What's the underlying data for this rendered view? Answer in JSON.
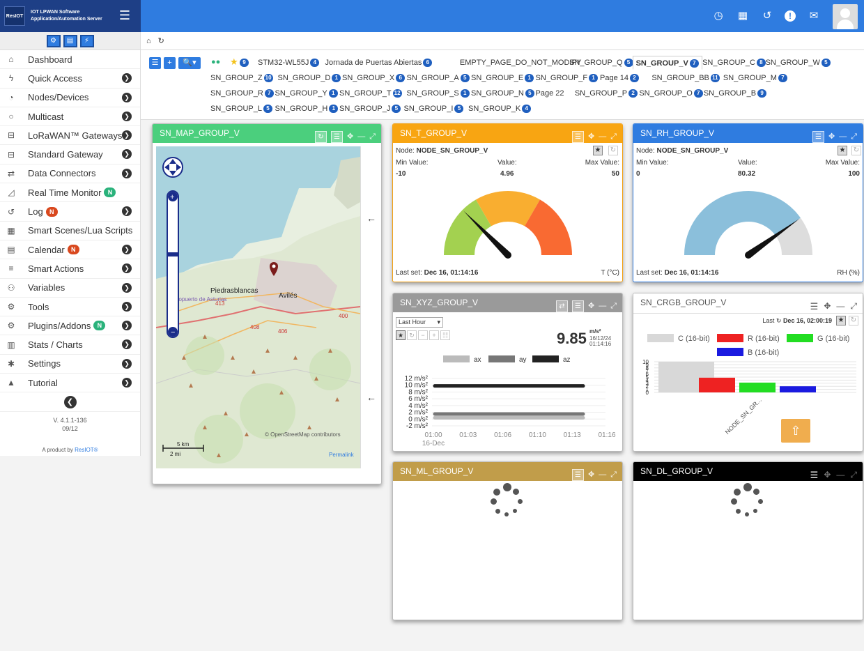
{
  "brand": {
    "logo": "ResIOT",
    "line1": "IOT LPWAN Software",
    "line2": "Application/Automation Server"
  },
  "topbar": {
    "icons": [
      "clock-icon",
      "film-icon",
      "history-icon",
      "alert-icon",
      "envelope-icon"
    ]
  },
  "sidebar": {
    "items": [
      {
        "label": "Dashboard",
        "icon": "home-icon",
        "arrow": false,
        "badge": ""
      },
      {
        "label": "Quick Access",
        "icon": "bolt-icon",
        "arrow": true,
        "badge": ""
      },
      {
        "label": "Nodes/Devices",
        "icon": "rss-icon",
        "arrow": true,
        "badge": ""
      },
      {
        "label": "Multicast",
        "icon": "circle-icon",
        "arrow": true,
        "badge": ""
      },
      {
        "label": "LoRaWAN™ Gateways",
        "icon": "hdd-icon",
        "arrow": true,
        "badge": ""
      },
      {
        "label": "Standard Gateway",
        "icon": "hdd-icon",
        "arrow": true,
        "badge": ""
      },
      {
        "label": "Data Connectors",
        "icon": "exchange-icon",
        "arrow": true,
        "badge": ""
      },
      {
        "label": "Real Time Monitor",
        "icon": "area-chart-icon",
        "arrow": false,
        "badge": "N",
        "badge_color": "green"
      },
      {
        "label": "Log",
        "icon": "history-icon",
        "arrow": true,
        "badge": "N",
        "badge_color": "red"
      },
      {
        "label": "Smart Scenes/Lua Scripts",
        "icon": "film-icon",
        "arrow": false,
        "badge": ""
      },
      {
        "label": "Calendar",
        "icon": "calendar-icon",
        "arrow": true,
        "badge": "N",
        "badge_color": "red"
      },
      {
        "label": "Smart Actions",
        "icon": "list-icon",
        "arrow": true,
        "badge": ""
      },
      {
        "label": "Variables",
        "icon": "sitemap-icon",
        "arrow": true,
        "badge": ""
      },
      {
        "label": "Tools",
        "icon": "cogs-icon",
        "arrow": true,
        "badge": ""
      },
      {
        "label": "Plugins/Addons",
        "icon": "cogs-icon",
        "arrow": true,
        "badge": "N",
        "badge_color": "green"
      },
      {
        "label": "Stats / Charts",
        "icon": "bar-chart-icon",
        "arrow": true,
        "badge": ""
      },
      {
        "label": "Settings",
        "icon": "gear-icon",
        "arrow": true,
        "badge": ""
      },
      {
        "label": "Tutorial",
        "icon": "graduation-cap-icon",
        "arrow": true,
        "badge": ""
      }
    ],
    "version": "V. 4.1.1-136",
    "version_date": "09/12",
    "product": "A product by",
    "product_link": "ResIOT®"
  },
  "tabs": {
    "fav_count": "9",
    "row1": [
      [
        "STM32-WL55J",
        "4"
      ],
      [
        "Jornada de Puertas Abiertas",
        "6"
      ],
      [
        "EMPTY_PAGE_DO_NOT_MODIFY",
        ""
      ],
      [
        "SN_GROUP_Q",
        "5"
      ],
      [
        "SN_GROUP_V",
        "7"
      ],
      [
        "SN_GROUP_C",
        "8"
      ],
      [
        "SN_GROUP_W",
        "5"
      ]
    ],
    "row2": [
      [
        "SN_GROUP_Z",
        "10"
      ],
      [
        "SN_GROUP_D",
        "1"
      ],
      [
        "SN_GROUP_X",
        "6"
      ],
      [
        "SN_GROUP_A",
        "5"
      ],
      [
        "SN_GROUP_E",
        "1"
      ],
      [
        "SN_GROUP_F",
        "1"
      ],
      [
        "Page 14",
        "2"
      ],
      [
        "SN_GROUP_BB",
        "11"
      ],
      [
        "SN_GROUP_M",
        "7"
      ]
    ],
    "row3": [
      [
        "SN_GROUP_R",
        "7"
      ],
      [
        "SN_GROUP_Y",
        "1"
      ],
      [
        "SN_GROUP_T",
        "12"
      ],
      [
        "SN_GROUP_S",
        "1"
      ],
      [
        "SN_GROUP_N",
        "5"
      ],
      [
        "Page 22",
        ""
      ],
      [
        "SN_GROUP_P",
        "2"
      ],
      [
        "SN_GROUP_O",
        "7"
      ],
      [
        "SN_GROUP_B",
        "9"
      ]
    ],
    "row4": [
      [
        "SN_GROUP_L",
        "5"
      ],
      [
        "SN_GROUP_H",
        "1"
      ],
      [
        "SN_GROUP_J",
        "5"
      ],
      [
        "SN_GROUP_I",
        "5"
      ],
      [
        "SN_GROUP_K",
        "4"
      ]
    ],
    "active": "SN_GROUP_V"
  },
  "map": {
    "title": "SN_MAP_GROUP_V",
    "places": [
      "Piedrasblancas",
      "Avilés",
      "Aeropuerto de Asturias"
    ],
    "roads": [
      "413",
      "408",
      "406",
      "400"
    ],
    "attribution": "© OpenStreetMap contributors",
    "permalink": "Permalink",
    "scale_km": "5 km",
    "scale_mi": "2 mi"
  },
  "t_widget": {
    "title": "SN_T_GROUP_V",
    "node_label": "Node:",
    "node": "NODE_SN_GROUP_V",
    "min_label": "Min Value:",
    "value_label": "Value:",
    "max_label": "Max Value:",
    "min": "-10",
    "value": "4.96",
    "max": "50",
    "last_label": "Last set:",
    "last": "Dec 16, 01:14:16",
    "unit": "T (°C)",
    "gauge": {
      "min": -10,
      "max": 50,
      "value": 4.96,
      "bands": [
        [
          "#a3d150",
          -10,
          10
        ],
        [
          "#f9ae30",
          10,
          30
        ],
        [
          "#f96a32",
          30,
          50
        ]
      ]
    }
  },
  "rh_widget": {
    "title": "SN_RH_GROUP_V",
    "node_label": "Node:",
    "node": "NODE_SN_GROUP_V",
    "min_label": "Min Value:",
    "value_label": "Value:",
    "max_label": "Max Value:",
    "min": "0",
    "value": "80.32",
    "max": "100",
    "last_label": "Last set:",
    "last": "Dec 16, 01:14:16",
    "unit": "RH (%)",
    "gauge": {
      "min": 0,
      "max": 100,
      "value": 80.32,
      "bands": [
        [
          "#8bbfdb",
          0,
          80.32
        ],
        [
          "#dddddd",
          80.32,
          100
        ]
      ]
    }
  },
  "xyz_widget": {
    "title": "SN_XYZ_GROUP_V",
    "range": "Last Hour",
    "value": "9.85",
    "unit": "m/s²",
    "date": "16/12/24",
    "time": "01:14:16"
  },
  "chart_data": [
    {
      "type": "line",
      "x": [
        "01:00",
        "01:03",
        "01:06",
        "01:10",
        "01:13",
        "01:16"
      ],
      "x_sub": "16-Dec",
      "y_ticks": [
        "12 m/s²",
        "10 m/s²",
        "8 m/s²",
        "6 m/s²",
        "4 m/s²",
        "2 m/s²",
        "0 m/s²",
        "-2 m/s²"
      ],
      "ylim": [
        -2,
        12
      ],
      "series": [
        {
          "name": "ax",
          "color": "#bbbbbb",
          "values": [
            0.4,
            0.4
          ]
        },
        {
          "name": "ay",
          "color": "#777777",
          "values": [
            1.5,
            1.5
          ]
        },
        {
          "name": "az",
          "color": "#222222",
          "values": [
            9.8,
            9.8
          ]
        }
      ]
    },
    {
      "type": "bar",
      "categories": [
        "NODE_SN_GR..."
      ],
      "series": [
        {
          "name": "C (16-bit)",
          "color": "#d8d8d8",
          "values": [
            10
          ]
        },
        {
          "name": "R (16-bit)",
          "color": "#ee2222",
          "values": [
            4.8
          ]
        },
        {
          "name": "G (16-bit)",
          "color": "#22dd22",
          "values": [
            3.2
          ]
        },
        {
          "name": "B (16-bit)",
          "color": "#1a1ae0",
          "values": [
            2
          ]
        }
      ],
      "ylim": [
        0,
        10
      ],
      "y_ticks": [
        "10",
        "9",
        "8",
        "7",
        "6",
        "5",
        "4",
        "3",
        "2",
        "1",
        "0"
      ]
    }
  ],
  "crgb_widget": {
    "title": "SN_CRGB_GROUP_V",
    "last_label": "Last",
    "last": "Dec 16, 02:00:19"
  },
  "ml_widget": {
    "title": "SN_ML_GROUP_V"
  },
  "dl_widget": {
    "title": "SN_DL_GROUP_V"
  }
}
